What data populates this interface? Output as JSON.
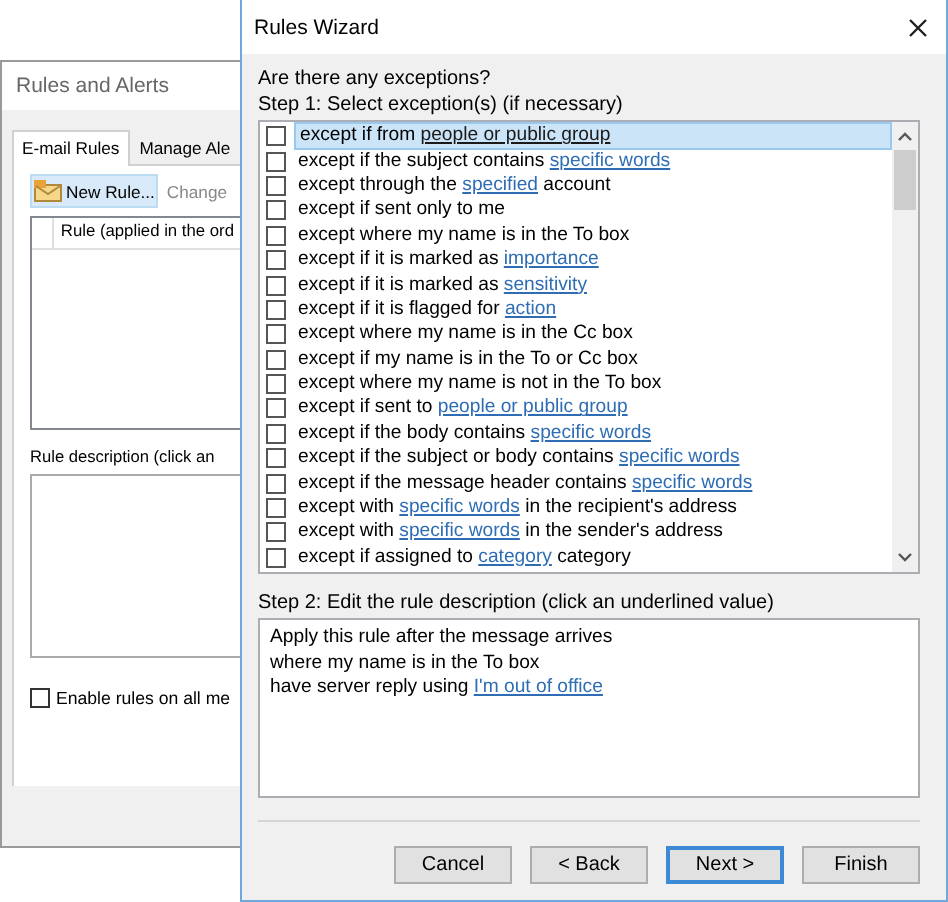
{
  "background_window": {
    "title": "Rules and Alerts",
    "tabs": [
      {
        "label": "E-mail Rules",
        "selected": true
      },
      {
        "label": "Manage Ale",
        "selected": false
      }
    ],
    "toolbar": [
      {
        "label": "New Rule...",
        "highlighted": true,
        "kind": "new"
      },
      {
        "label": "Change",
        "highlighted": false,
        "kind": "plain"
      }
    ],
    "rules_table": {
      "columns": [
        "Rule (applied in the ord"
      ]
    },
    "description_label": "Rule description (click an",
    "enable_all": {
      "label": "Enable rules on all me",
      "checked": false
    }
  },
  "wizard": {
    "title": "Rules Wizard",
    "prompt": "Are there any exceptions?",
    "step1_label": "Step 1: Select exception(s) (if necessary)",
    "exceptions": [
      {
        "checked": false,
        "selected": true,
        "parts": [
          {
            "text": "except if from "
          },
          {
            "text": "people or public group",
            "link": true
          }
        ]
      },
      {
        "checked": false,
        "selected": false,
        "parts": [
          {
            "text": "except if the subject contains "
          },
          {
            "text": "specific words",
            "link": true
          }
        ]
      },
      {
        "checked": false,
        "selected": false,
        "parts": [
          {
            "text": "except through the "
          },
          {
            "text": "specified",
            "link": true
          },
          {
            "text": " account"
          }
        ]
      },
      {
        "checked": false,
        "selected": false,
        "parts": [
          {
            "text": "except if sent only to me"
          }
        ]
      },
      {
        "checked": false,
        "selected": false,
        "parts": [
          {
            "text": "except where my name is in the To box"
          }
        ]
      },
      {
        "checked": false,
        "selected": false,
        "parts": [
          {
            "text": "except if it is marked as "
          },
          {
            "text": "importance",
            "link": true
          }
        ]
      },
      {
        "checked": false,
        "selected": false,
        "parts": [
          {
            "text": "except if it is marked as "
          },
          {
            "text": "sensitivity",
            "link": true
          }
        ]
      },
      {
        "checked": false,
        "selected": false,
        "parts": [
          {
            "text": "except if it is flagged for "
          },
          {
            "text": "action",
            "link": true
          }
        ]
      },
      {
        "checked": false,
        "selected": false,
        "parts": [
          {
            "text": "except where my name is in the Cc box"
          }
        ]
      },
      {
        "checked": false,
        "selected": false,
        "parts": [
          {
            "text": "except if my name is in the To or Cc box"
          }
        ]
      },
      {
        "checked": false,
        "selected": false,
        "parts": [
          {
            "text": "except where my name is not in the To box"
          }
        ]
      },
      {
        "checked": false,
        "selected": false,
        "parts": [
          {
            "text": "except if sent to "
          },
          {
            "text": "people or public group",
            "link": true
          }
        ]
      },
      {
        "checked": false,
        "selected": false,
        "parts": [
          {
            "text": "except if the body contains "
          },
          {
            "text": "specific words",
            "link": true
          }
        ]
      },
      {
        "checked": false,
        "selected": false,
        "parts": [
          {
            "text": "except if the subject or body contains "
          },
          {
            "text": "specific words",
            "link": true
          }
        ]
      },
      {
        "checked": false,
        "selected": false,
        "parts": [
          {
            "text": "except if the message header contains "
          },
          {
            "text": "specific words",
            "link": true
          }
        ]
      },
      {
        "checked": false,
        "selected": false,
        "parts": [
          {
            "text": "except with "
          },
          {
            "text": "specific words",
            "link": true
          },
          {
            "text": " in the recipient's address"
          }
        ]
      },
      {
        "checked": false,
        "selected": false,
        "parts": [
          {
            "text": "except with "
          },
          {
            "text": "specific words",
            "link": true
          },
          {
            "text": " in the sender's address"
          }
        ]
      },
      {
        "checked": false,
        "selected": false,
        "parts": [
          {
            "text": "except if assigned to "
          },
          {
            "text": "category",
            "link": true
          },
          {
            "text": " category"
          }
        ]
      }
    ],
    "step2_label": "Step 2: Edit the rule description (click an underlined value)",
    "description": [
      [
        {
          "text": "Apply this rule after the message arrives"
        }
      ],
      [
        {
          "text": "where my name is in the To box"
        }
      ],
      [
        {
          "text": "have server reply using "
        },
        {
          "text": "I'm out of office",
          "link": true
        }
      ]
    ],
    "buttons": [
      {
        "label": "Cancel",
        "default": false
      },
      {
        "label": "< Back",
        "default": false
      },
      {
        "label": "Next >",
        "default": true
      },
      {
        "label": "Finish",
        "default": false
      }
    ]
  }
}
